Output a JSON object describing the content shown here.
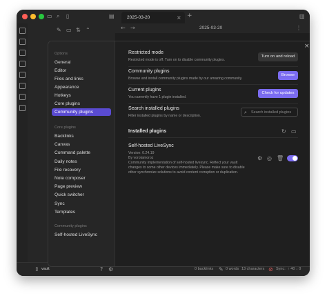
{
  "window": {
    "tab_title": "2025-03-20",
    "note_title": "2025-03-20",
    "vault_name": "vault",
    "colors": {
      "close": "#ff5f57",
      "minimize": "#febc2e",
      "maximize": "#28c840",
      "accent": "#7b6cf0",
      "active_nav": "#5a4bd1"
    }
  },
  "settings_nav": {
    "options_title": "Options",
    "options": [
      "General",
      "Editor",
      "Files and links",
      "Appearance",
      "Hotkeys",
      "Core plugins",
      "Community plugins"
    ],
    "active": "Community plugins",
    "core_plugins_title": "Core plugins",
    "core_plugins": [
      "Backlinks",
      "Canvas",
      "Command palette",
      "Daily notes",
      "File recovery",
      "Note composer",
      "Page preview",
      "Quick switcher",
      "Sync",
      "Templates"
    ],
    "community_title": "Community plugins",
    "community": [
      "Self-hosted LiveSync"
    ]
  },
  "content": {
    "restricted": {
      "title": "Restricted mode",
      "desc": "Restricted mode is off. Turn on to disable community plugins.",
      "button": "Turn on and reload"
    },
    "community": {
      "title": "Community plugins",
      "desc": "Browse and install community plugins made by our amazing community.",
      "button": "Browse"
    },
    "current": {
      "title": "Current plugins",
      "desc": "You currently have 1 plugin installed.",
      "button": "Check for updates"
    },
    "search": {
      "title": "Search installed plugins",
      "desc": "Filter installed plugins by name or description.",
      "placeholder": "Search installed plugins"
    },
    "installed_title": "Installed plugins",
    "plugin": {
      "name": "Self-hosted LiveSync",
      "version": "Version: 0.24.19",
      "author": "By vorotamoroz",
      "desc_lines": [
        "Community implementation of self-hosted livesync. Reflect your vault",
        "changes to some other devices immediately. Please make sure to disable",
        "other synchronize solutions to avoid content corruption or duplication."
      ],
      "enabled": true
    }
  },
  "statusbar": {
    "backlinks": "0 backlinks",
    "words": "0 words",
    "characters": "13 characters",
    "sync": "Sync:",
    "sync_stats": "↑ 40 ↓ 0"
  },
  "icons": {
    "close": "close-icon",
    "search": "search-icon",
    "refresh": "refresh-icon",
    "folder": "folder-icon",
    "gear": "gear-icon",
    "heart": "heart-icon",
    "trash": "trash-icon",
    "help": "help-icon"
  }
}
